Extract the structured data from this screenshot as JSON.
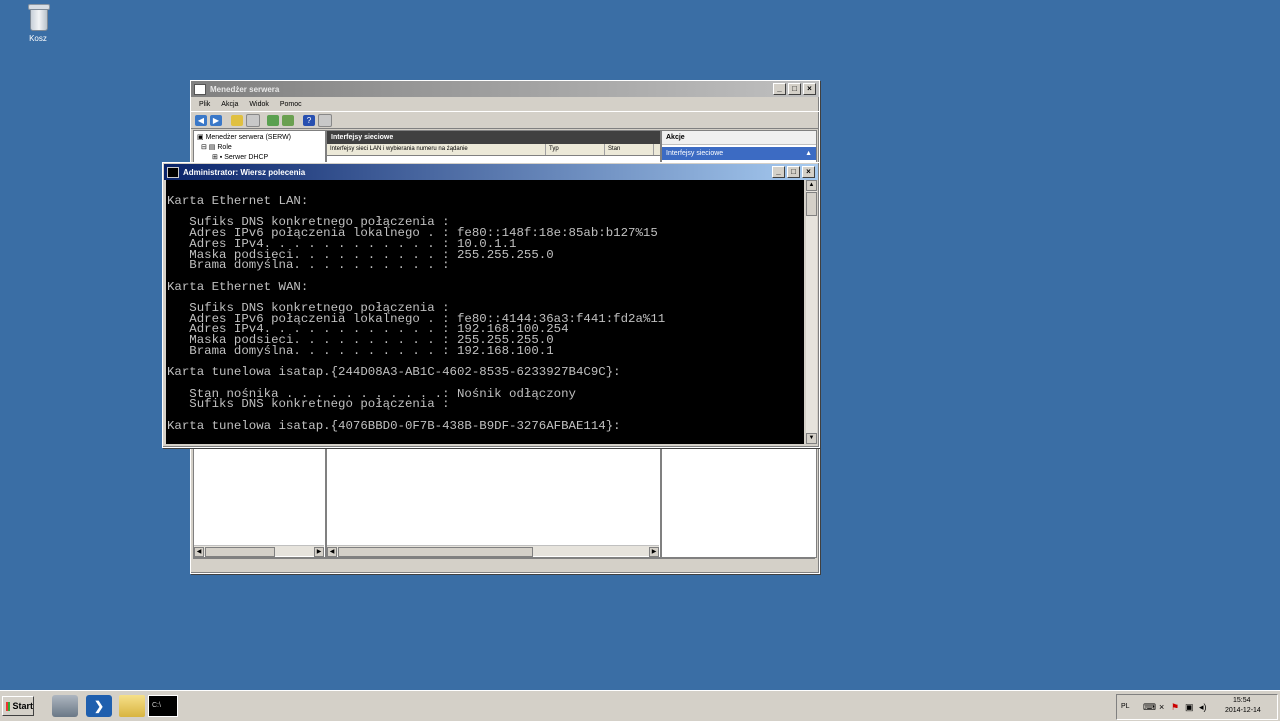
{
  "desktop": {
    "recycle_bin_label": "Kosz"
  },
  "server_manager": {
    "title": "Menedżer serwera",
    "menu": [
      "Plik",
      "Akcja",
      "Widok",
      "Pomoc"
    ],
    "tree": {
      "root": "Menedżer serwera (SERW)",
      "roles": "Role",
      "dhcp": "Serwer DHCP"
    },
    "center": {
      "header": "Interfejsy sieciowe",
      "columns": [
        "Interfejsy sieci LAN i wybierania numeru na żądanie",
        "Typ",
        "Stan"
      ]
    },
    "actions": {
      "header": "Akcje",
      "item": "Interfejsy sieciowe"
    }
  },
  "cmd": {
    "title": "Administrator: Wiersz polecenia",
    "lines": [
      "Karta Ethernet LAN:",
      "",
      "   Sufiks DNS konkretnego połączenia :",
      "   Adres IPv6 połączenia lokalnego . : fe80::148f:18e:85ab:b127%15",
      "   Adres IPv4. . . . . . . . . . . . : 10.0.1.1",
      "   Maska podsieci. . . . . . . . . . : 255.255.255.0",
      "   Brama domyślna. . . . . . . . . . :",
      "",
      "Karta Ethernet WAN:",
      "",
      "   Sufiks DNS konkretnego połączenia :",
      "   Adres IPv6 połączenia lokalnego . : fe80::4144:36a3:f441:fd2a%11",
      "   Adres IPv4. . . . . . . . . . . . : 192.168.100.254",
      "   Maska podsieci. . . . . . . . . . : 255.255.255.0",
      "   Brama domyślna. . . . . . . . . . : 192.168.100.1",
      "",
      "Karta tunelowa isatap.{244D08A3-AB1C-4602-8535-6233927B4C9C}:",
      "",
      "   Stan nośnika . . . . . . . . . . .: Nośnik odłączony",
      "   Sufiks DNS konkretnego połączenia :",
      "",
      "Karta tunelowa isatap.{4076BBD0-0F7B-438B-B9DF-3276AFBAE114}:"
    ]
  },
  "taskbar": {
    "start_label": "Start",
    "language": "PL",
    "time": "15:54",
    "date": "2014-12-14"
  }
}
